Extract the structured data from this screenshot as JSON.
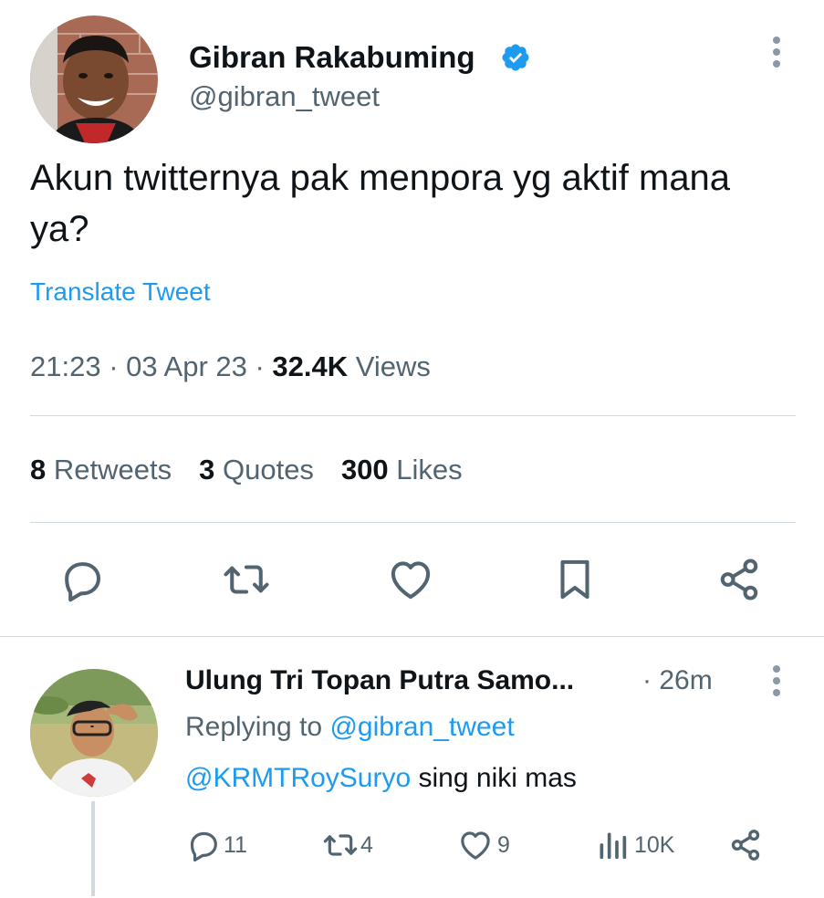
{
  "tweet": {
    "author_name": "Gibran Rakabuming",
    "author_handle": "@gibran_tweet",
    "text": "Akun twitternya pak menpora yg aktif mana ya?",
    "translate_label": "Translate Tweet",
    "time": "21:23",
    "date": "03 Apr 23",
    "views_count": "32.4K",
    "views_label": "Views",
    "retweets_count": "8",
    "retweets_label": "Retweets",
    "quotes_count": "3",
    "quotes_label": "Quotes",
    "likes_count": "300",
    "likes_label": "Likes"
  },
  "reply": {
    "author_name": "Ulung Tri Topan Putra Samo...",
    "time": "26m",
    "replying_prefix": "Replying to",
    "replying_handle": "@gibran_tweet",
    "mention": "@KRMTRoySuryo",
    "text": "sing niki mas",
    "reply_count": "11",
    "retweet_count": "4",
    "like_count": "9",
    "views_count": "10K"
  },
  "colors": {
    "accent": "#1d9bf0",
    "text": "#0f1419",
    "secondary": "#536471",
    "divider": "#cfd9de"
  }
}
